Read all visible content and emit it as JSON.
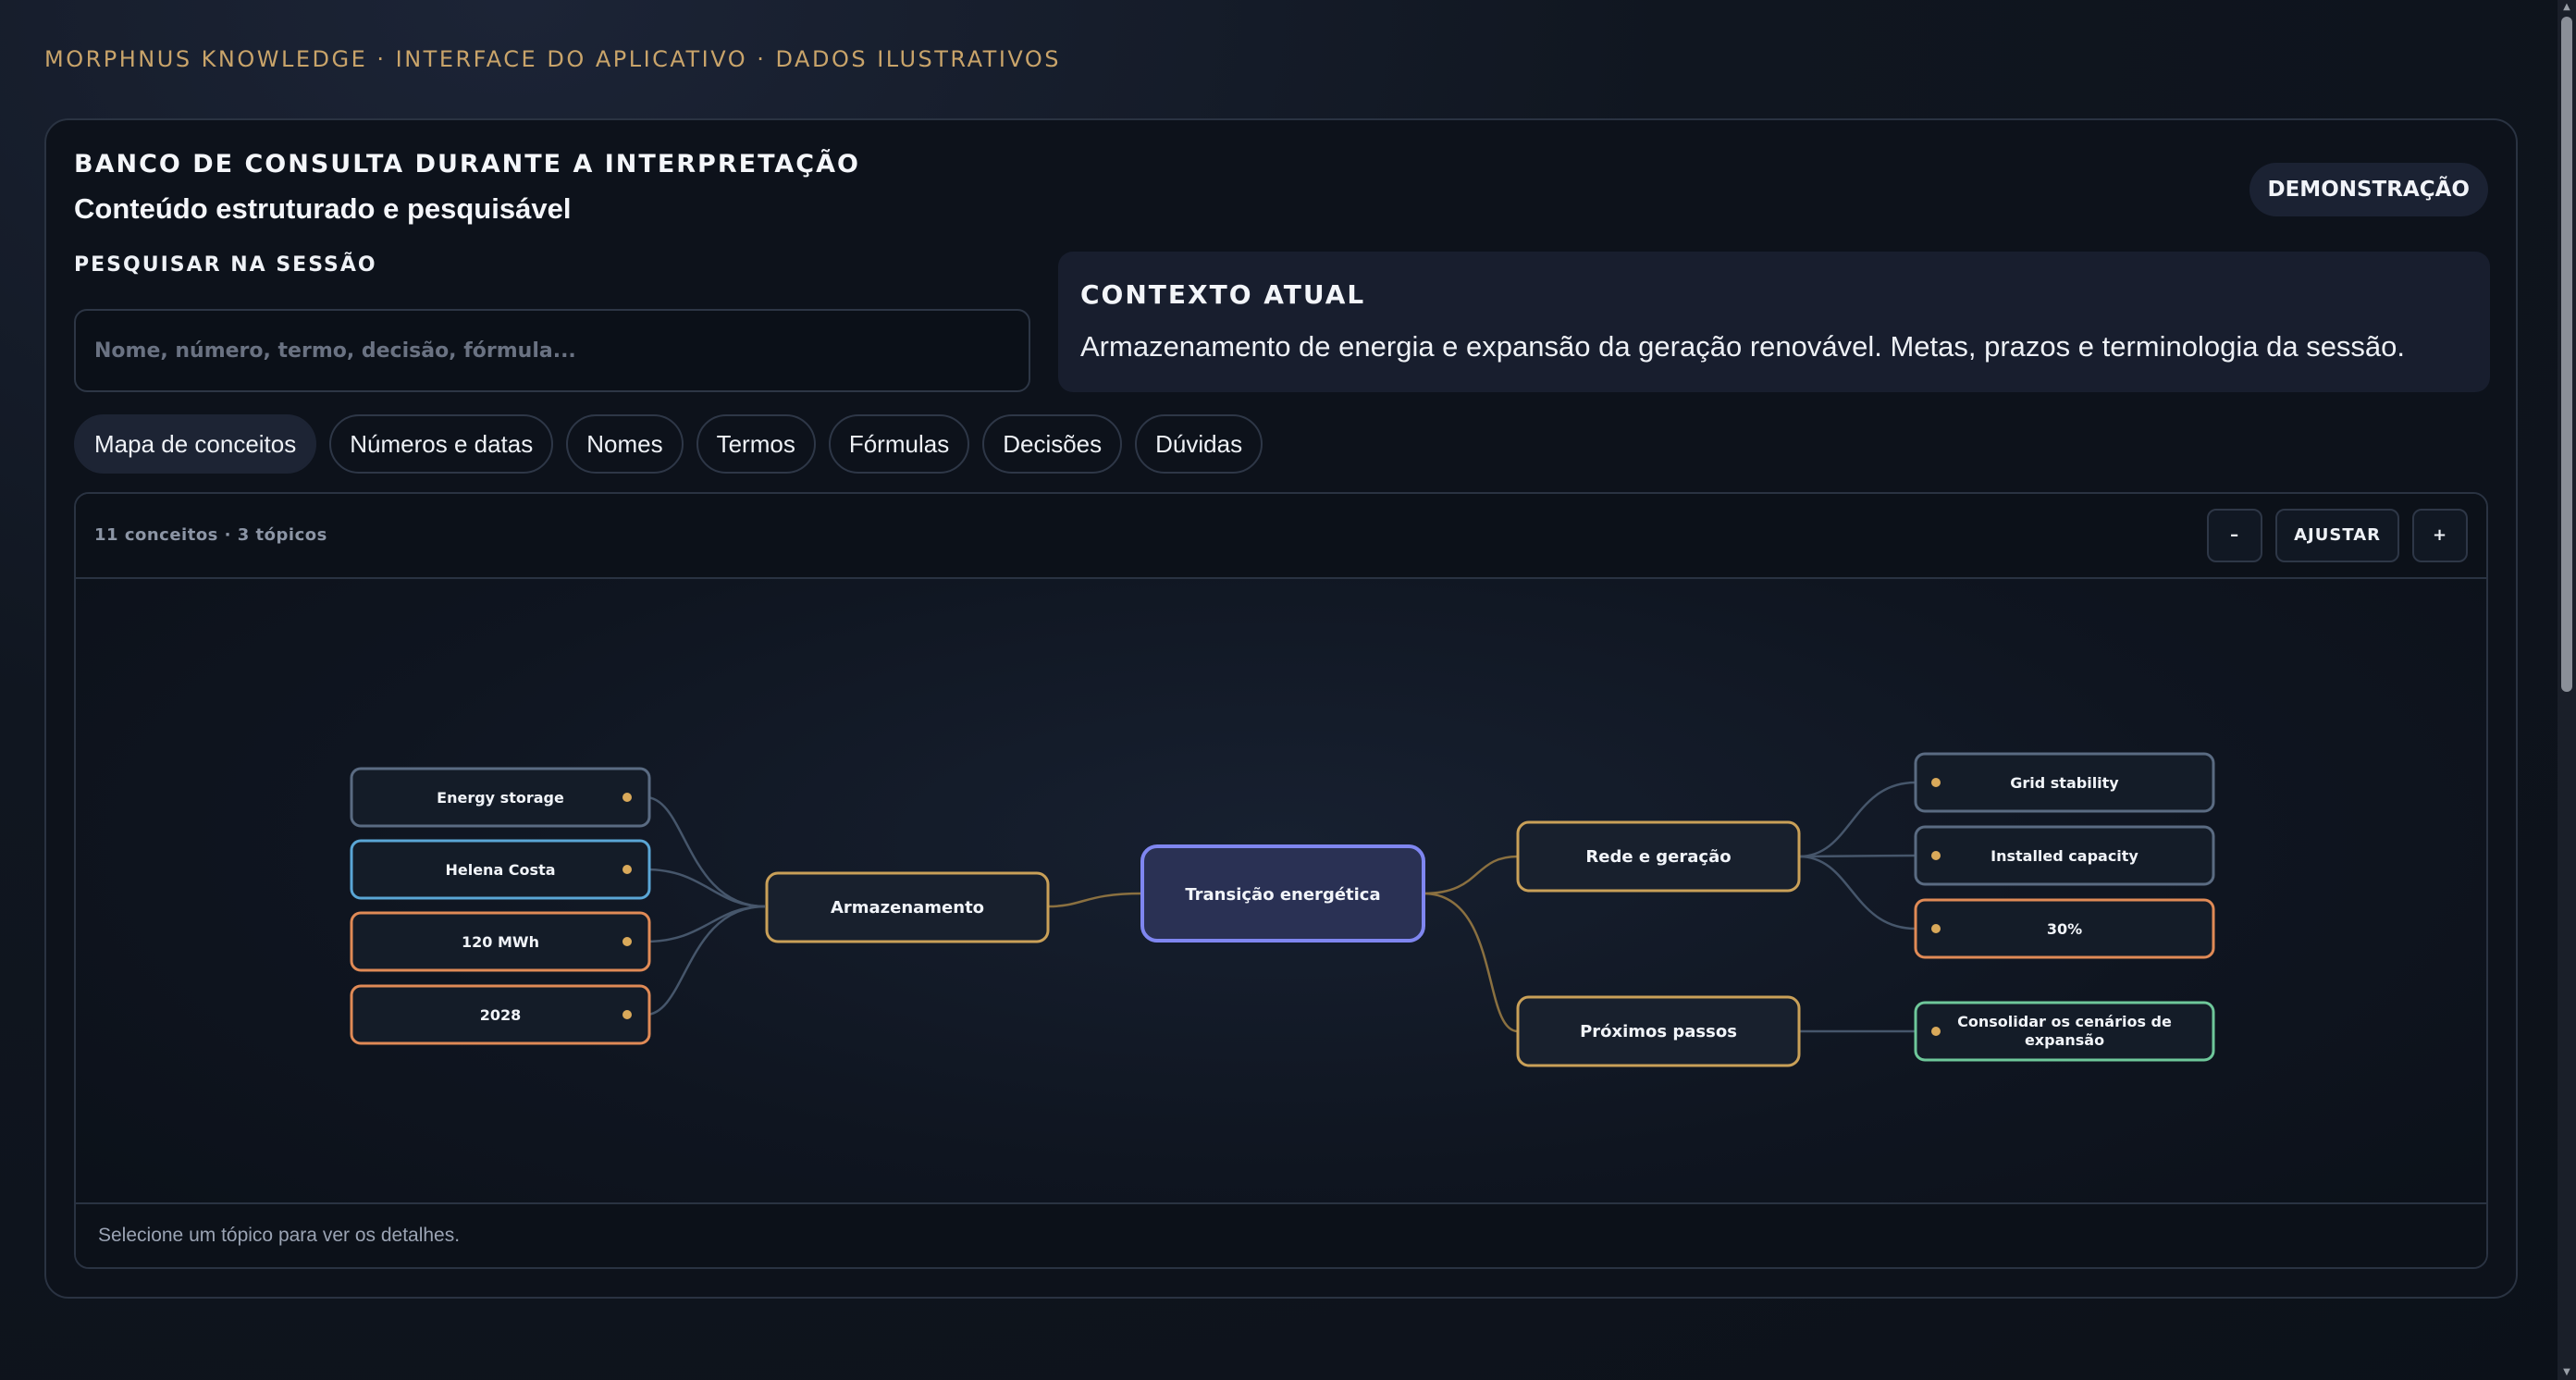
{
  "brand": "MORPHNUS KNOWLEDGE · INTERFACE DO APLICATIVO · DADOS ILUSTRATIVOS",
  "header": {
    "kicker": "BANCO DE CONSULTA DURANTE A INTERPRETAÇÃO",
    "subtitle": "Conteúdo estruturado e pesquisável",
    "badge": "DEMONSTRAÇÃO"
  },
  "search": {
    "label": "PESQUISAR NA SESSÃO",
    "placeholder": "Nome, número, termo, decisão, fórmula...",
    "value": ""
  },
  "context": {
    "title": "CONTEXTO ATUAL",
    "text": "Armazenamento de energia e expansão da geração renovável. Metas, prazos e terminologia da sessão."
  },
  "tabs": [
    {
      "label": "Mapa de conceitos",
      "active": true
    },
    {
      "label": "Números e datas",
      "active": false
    },
    {
      "label": "Nomes",
      "active": false
    },
    {
      "label": "Termos",
      "active": false
    },
    {
      "label": "Fórmulas",
      "active": false
    },
    {
      "label": "Decisões",
      "active": false
    },
    {
      "label": "Dúvidas",
      "active": false
    }
  ],
  "map": {
    "count": "11 conceitos · 3 tópicos",
    "zoom_out": "–",
    "fit": "AJUSTAR",
    "zoom_in": "+",
    "footer": "Selecione um tópico para ver os detalhes.",
    "root": "Transição energética",
    "topics": [
      "Armazenamento",
      "Rede e geração",
      "Próximos passos"
    ],
    "leaves": {
      "armazenamento": [
        "Energy storage",
        "Helena Costa",
        "120 MWh",
        "2028"
      ],
      "rede": [
        "Grid stability",
        "Installed capacity",
        "30%"
      ],
      "proximos": [
        "Consolidar os cenários de",
        "expansão"
      ]
    },
    "colors": {
      "root": "#7f86f0",
      "topic": "#c9a058",
      "term": "#5a6b82",
      "name": "#5aa6d6",
      "number": "#e08a56",
      "decision": "#6ec79a",
      "dot": "#d9a95a",
      "link": "#46566b"
    }
  }
}
